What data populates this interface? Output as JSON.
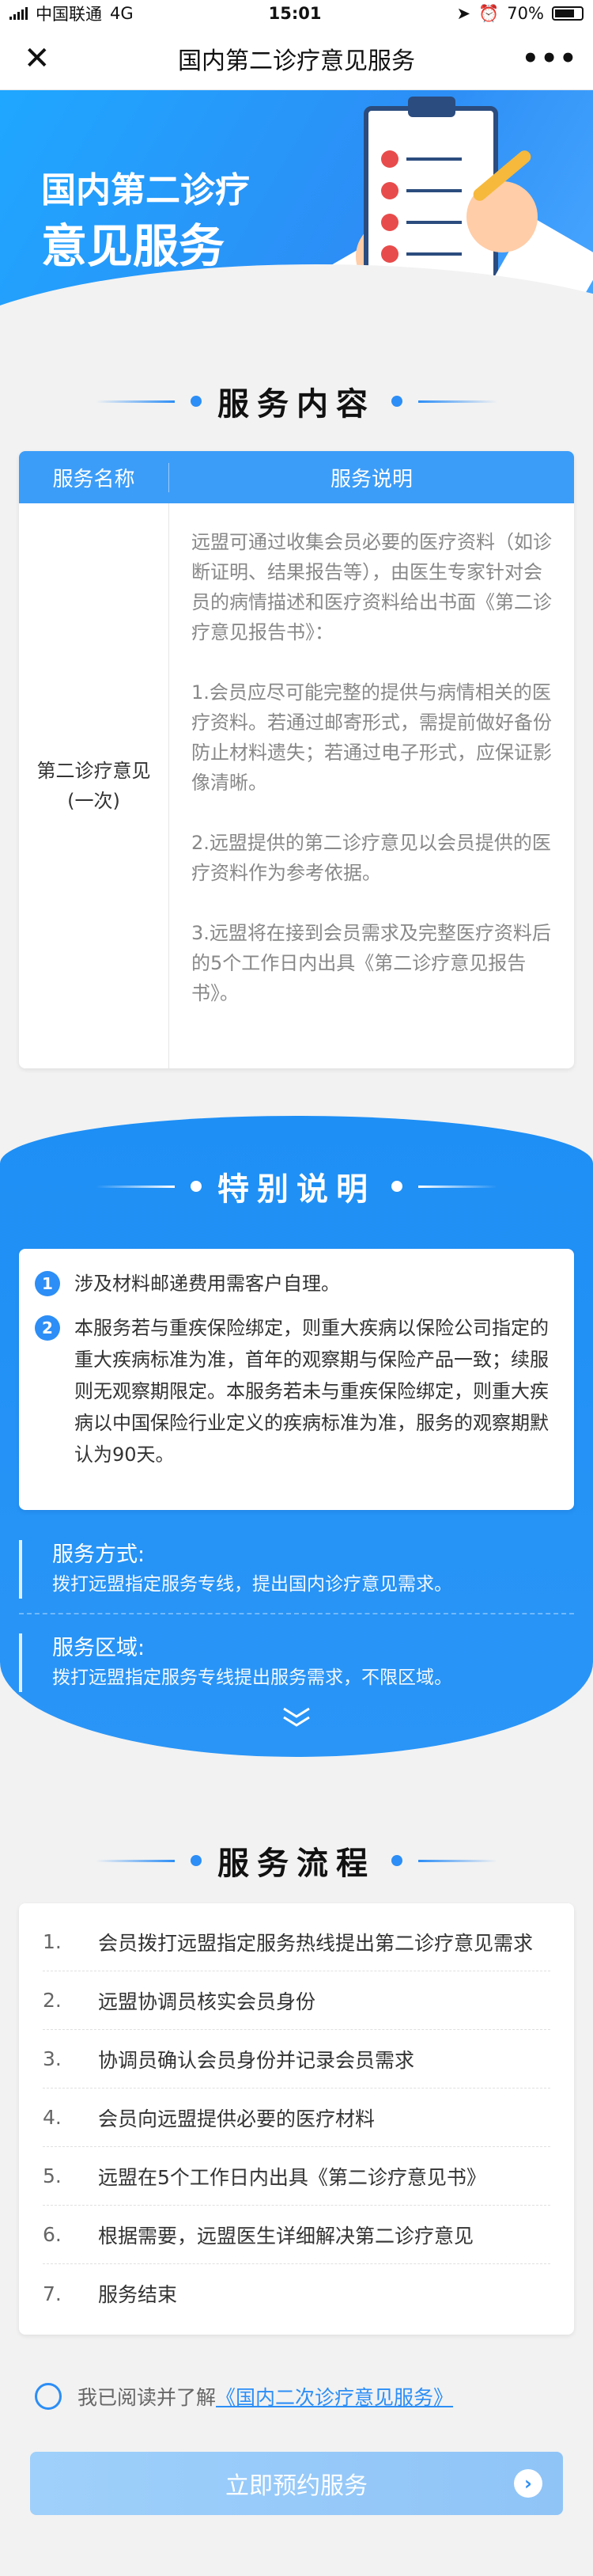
{
  "status_bar": {
    "carrier": "中国联通",
    "network": "4G",
    "time": "15:01",
    "battery": "70%"
  },
  "nav": {
    "title": "国内第二诊疗意见服务",
    "close_icon": "close-icon",
    "more_icon": "more-icon"
  },
  "banner": {
    "line1": "国内第二诊疗",
    "line2": "意见服务"
  },
  "service_content": {
    "heading": "服务内容",
    "col_name": "服务名称",
    "col_desc": "服务说明",
    "row_name_line1": "第二诊疗意见",
    "row_name_line2": "(一次)",
    "paragraphs": [
      "远盟可通过收集会员必要的医疗资料（如诊断证明、结果报告等），由医生专家针对会员的病情描述和医疗资料给出书面《第二诊疗意见报告书》：",
      "1.会员应尽可能完整的提供与病情相关的医疗资料。若通过邮寄形式，需提前做好备份防止材料遗失；若通过电子形式，应保证影像清晰。",
      "2.远盟提供的第二诊疗意见以会员提供的医疗资料作为参考依据。",
      "3.远盟将在接到会员需求及完整医疗资料后的5个工作日内出具《第二诊疗意见报告书》。"
    ]
  },
  "special": {
    "heading": "特别说明",
    "items": [
      {
        "num": "1",
        "text": "涉及材料邮递费用需客户自理。"
      },
      {
        "num": "2",
        "text": "本服务若与重疾保险绑定，则重大疾病以保险公司指定的重大疾病标准为准，首年的观察期与保险产品一致；续服则无观察期限定。本服务若未与重疾保险绑定，则重大疾病以中国保险行业定义的疾病标准为准，服务的观察期默认为90天。"
      }
    ],
    "method_title": "服务方式:",
    "method_desc": "拨打远盟指定服务专线，提出国内诊疗意见需求。",
    "area_title": "服务区域:",
    "area_desc": "拨打远盟指定服务专线提出服务需求，不限区域。"
  },
  "process": {
    "heading": "服务流程",
    "steps": [
      {
        "n": "1.",
        "text": "会员拨打远盟指定服务热线提出第二诊疗意见需求"
      },
      {
        "n": "2.",
        "text": "远盟协调员核实会员身份"
      },
      {
        "n": "3.",
        "text": "协调员确认会员身份并记录会员需求"
      },
      {
        "n": "4.",
        "text": "会员向远盟提供必要的医疗材料"
      },
      {
        "n": "5.",
        "text": "远盟在5个工作日内出具《第二诊疗意见书》"
      },
      {
        "n": "6.",
        "text": "根据需要，远盟医生详细解决第二诊疗意见"
      },
      {
        "n": "7.",
        "text": "服务结束"
      }
    ]
  },
  "agreement": {
    "prefix": "我已阅读并了解",
    "link": "《国内二次诊疗意见服务》"
  },
  "cta": {
    "label": "立即预约服务"
  }
}
